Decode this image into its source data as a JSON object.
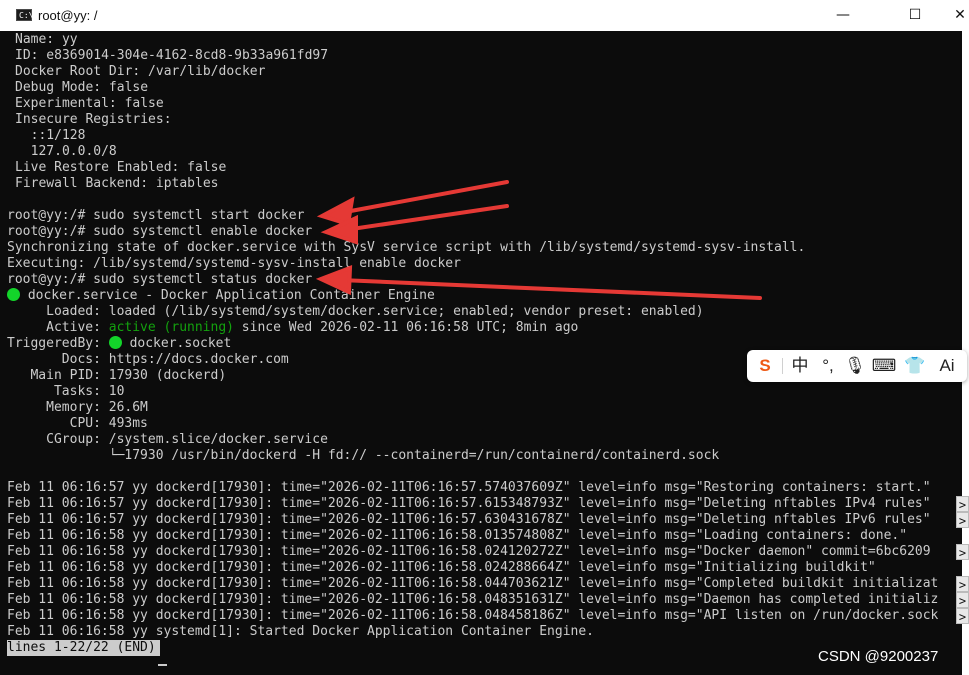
{
  "window": {
    "title": "root@yy: /",
    "icon_text": "C:\\",
    "buttons": {
      "minimize": "—",
      "maximize": "☐",
      "close": "✕"
    }
  },
  "terminal": {
    "lines": [
      "Name: yy",
      "ID: e8369014-304e-4162-8cd8-9b33a961fd97",
      "Docker Root Dir: /var/lib/docker",
      "Debug Mode: false",
      "Experimental: false",
      "Insecure Registries:",
      "  ::1/128",
      "  127.0.0.0/8",
      "Live Restore Enabled: false",
      "Firewall Backend: iptables",
      "",
      "root@yy:/# sudo systemctl start docker",
      "root@yy:/# sudo systemctl enable docker",
      "Synchronizing state of docker.service with SysV service script with /lib/systemd/systemd-sysv-install.",
      "Executing: /lib/systemd/systemd-sysv-install enable docker",
      "root@yy:/# sudo systemctl status docker"
    ],
    "status": {
      "service_title": " docker.service - Docker Application Container Engine",
      "loaded": "     Loaded: loaded (/lib/systemd/system/docker.service; enabled; vendor preset: enabled)",
      "active_label": "     Active: ",
      "active_value": "active (running)",
      "active_rest": " since Wed 2026-02-11 06:16:58 UTC; 8min ago",
      "triggered_label": "TriggeredBy: ",
      "triggered_value": " docker.socket",
      "docs": "       Docs: https://docs.docker.com",
      "main_pid": "   Main PID: 17930 (dockerd)",
      "tasks": "      Tasks: 10",
      "memory": "     Memory: 26.6M",
      "cpu": "        CPU: 493ms",
      "cgroup": "     CGroup: /system.slice/docker.service",
      "cgroup_child": "             └─17930 /usr/bin/dockerd -H fd:// --containerd=/run/containerd/containerd.sock"
    },
    "logs": [
      "Feb 11 06:16:57 yy dockerd[17930]: time=\"2026-02-11T06:16:57.574037609Z\" level=info msg=\"Restoring containers: start.\"",
      "Feb 11 06:16:57 yy dockerd[17930]: time=\"2026-02-11T06:16:57.615348793Z\" level=info msg=\"Deleting nftables IPv4 rules\"",
      "Feb 11 06:16:57 yy dockerd[17930]: time=\"2026-02-11T06:16:57.630431678Z\" level=info msg=\"Deleting nftables IPv6 rules\"",
      "Feb 11 06:16:58 yy dockerd[17930]: time=\"2026-02-11T06:16:58.013574808Z\" level=info msg=\"Loading containers: done.\"",
      "Feb 11 06:16:58 yy dockerd[17930]: time=\"2026-02-11T06:16:58.024120272Z\" level=info msg=\"Docker daemon\" commit=6bc6209",
      "Feb 11 06:16:58 yy dockerd[17930]: time=\"2026-02-11T06:16:58.024288664Z\" level=info msg=\"Initializing buildkit\"",
      "Feb 11 06:16:58 yy dockerd[17930]: time=\"2026-02-11T06:16:58.044703621Z\" level=info msg=\"Completed buildkit initializat",
      "Feb 11 06:16:58 yy dockerd[17930]: time=\"2026-02-11T06:16:58.048351631Z\" level=info msg=\"Daemon has completed initializ",
      "Feb 11 06:16:58 yy dockerd[17930]: time=\"2026-02-11T06:16:58.048458186Z\" level=info msg=\"API listen on /run/docker.sock",
      "Feb 11 06:16:58 yy systemd[1]: Started Docker Application Container Engine."
    ],
    "overflow_marker": ">",
    "pager_status": "lines 1-22/22 (END)"
  },
  "ime": {
    "logo": "S",
    "lang": "中",
    "punct": "°,",
    "mic": "🎙",
    "keyboard": "⌨",
    "skin": "👕",
    "ai": "Ai"
  },
  "watermark": "CSDN @9200237",
  "colors": {
    "terminal_bg": "#0c0c0c",
    "terminal_fg": "#cccccc",
    "active_green": "#13a10e",
    "status_dot": "#13d52a",
    "arrow_red": "#e53935",
    "ime_logo": "#ee5a16"
  }
}
